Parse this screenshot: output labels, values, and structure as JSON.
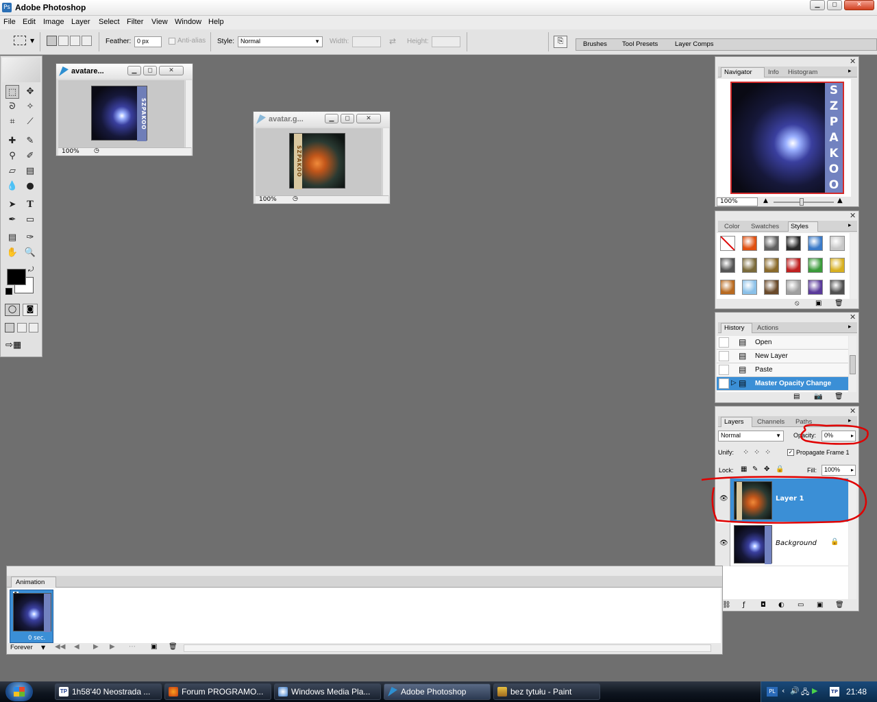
{
  "window": {
    "title": "Adobe Photoshop"
  },
  "menu": [
    "File",
    "Edit",
    "Image",
    "Layer",
    "Select",
    "Filter",
    "View",
    "Window",
    "Help"
  ],
  "options_bar": {
    "feather_label": "Feather:",
    "feather_value": "0 px",
    "antialias_label": "Anti-alias",
    "style_label": "Style:",
    "style_value": "Normal",
    "width_label": "Width:",
    "height_label": "Height:",
    "palette_tabs": [
      "Brushes",
      "Tool Presets",
      "Layer Comps"
    ]
  },
  "doc1": {
    "title": "avatare...",
    "zoom": "100%",
    "banner_text": "SZPAKOO"
  },
  "doc2": {
    "title": "avatar.g...",
    "zoom": "100%",
    "banner_text": "SZPAKOO"
  },
  "navigator": {
    "tabs": [
      "Navigator",
      "Info",
      "Histogram"
    ],
    "zoom": "100%",
    "banner_letters": [
      "S",
      "Z",
      "P",
      "A",
      "K",
      "O",
      "O"
    ]
  },
  "styles_panel": {
    "tabs": [
      "Color",
      "Swatches",
      "Styles"
    ],
    "swatches": [
      "#ffffff",
      "#e05010",
      "#606060",
      "#2a2a2a",
      "#3a7ac8",
      "#c8c8c8",
      "#555555",
      "#7a6a3a",
      "#8a6a2a",
      "#c02020",
      "#3a9a3a",
      "#d8b020",
      "#b86a20",
      "#8ac0e8",
      "#6a4a2a",
      "#a0a0a0",
      "#5a3a9a",
      "#505050"
    ]
  },
  "history_panel": {
    "tabs": [
      "History",
      "Actions"
    ],
    "items": [
      "Open",
      "New Layer",
      "Paste",
      "Master Opacity Change"
    ],
    "selected_index": 3
  },
  "layers_panel": {
    "tabs": [
      "Layers",
      "Channels",
      "Paths"
    ],
    "blend_mode": "Normal",
    "opacity_label": "Opacity:",
    "opacity_value": "0%",
    "unify_label": "Unify:",
    "propagate_label": "Propagate Frame 1",
    "lock_label": "Lock:",
    "fill_label": "Fill:",
    "fill_value": "100%",
    "layers": [
      {
        "name": "Layer 1",
        "selected": true
      },
      {
        "name": "Background",
        "selected": false
      }
    ]
  },
  "animation_panel": {
    "tab": "Animation",
    "frame_number": "1",
    "frame_delay": "0 sec.",
    "loop": "Forever"
  },
  "taskbar": {
    "buttons": [
      "1h58'40 Neostrada ...",
      "Forum PROGRAMO...",
      "Windows Media Pla...",
      "Adobe Photoshop",
      "bez tytułu - Paint"
    ],
    "active_index": 3,
    "tray_lang": "PL",
    "clock": "21:48"
  },
  "colors": {
    "selection_blue": "#3b8fd6",
    "annotation_red": "#e00000"
  }
}
